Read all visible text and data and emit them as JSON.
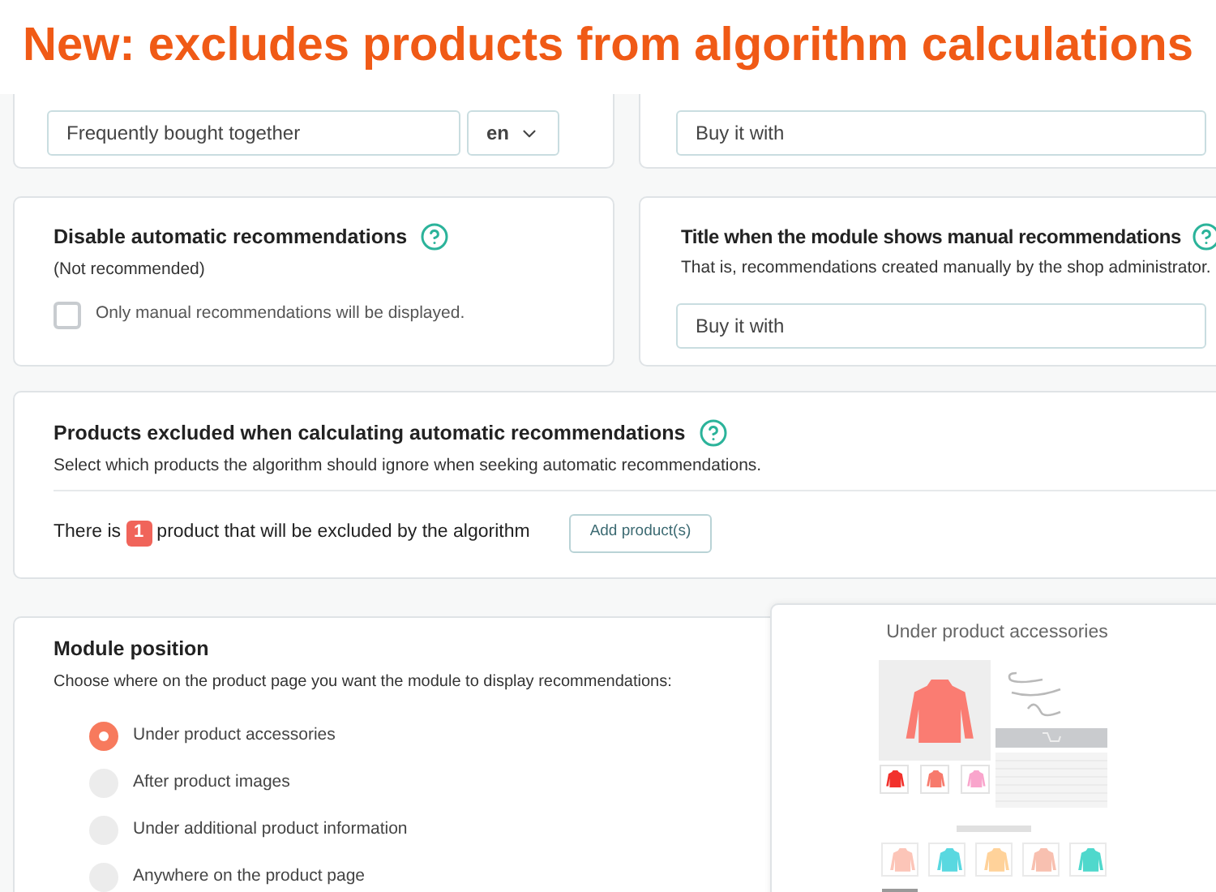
{
  "banner": {
    "title": "New: excludes products from algorithm calculations"
  },
  "title_card": {
    "input_value": "Frequently bought together",
    "language": "en"
  },
  "manual_title_card": {
    "input_value": "Buy it with"
  },
  "disable_card": {
    "title": "Disable automatic recommendations",
    "note": "(Not recommended)",
    "checkbox": {
      "label": "Only manual recommendations will be displayed.",
      "checked": false
    }
  },
  "manual_card": {
    "title": "Title when the module shows manual recommendations",
    "description": "That is, recommendations created manually by the shop administrator.",
    "input_value": "Buy it with"
  },
  "excluded_card": {
    "title": "Products excluded when calculating automatic recommendations",
    "description": "Select which products the algorithm should ignore when seeking automatic recommendations.",
    "count_prefix": "There is",
    "count": "1",
    "count_suffix": "product that will be excluded by the algorithm",
    "button": "Add product(s)"
  },
  "position_card": {
    "title": "Module position",
    "description": "Choose where on the product page you want the module to display recommendations:",
    "options": [
      {
        "label": "Under product accessories",
        "selected": true
      },
      {
        "label": "After product images",
        "selected": false
      },
      {
        "label": "Under additional product information",
        "selected": false
      },
      {
        "label": "Anywhere on the product page",
        "selected": false
      }
    ]
  },
  "preview": {
    "title": "Under product accessories"
  }
}
